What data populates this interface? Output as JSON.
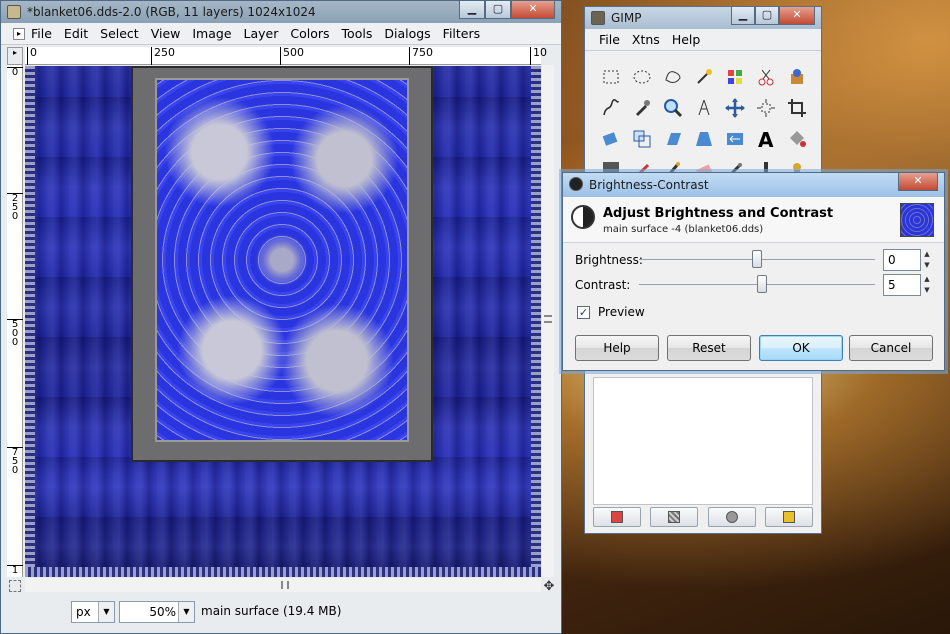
{
  "image_window": {
    "title": "*blanket06.dds-2.0 (RGB, 11 layers) 1024x1024",
    "menu": [
      "File",
      "Edit",
      "Select",
      "View",
      "Image",
      "Layer",
      "Colors",
      "Tools",
      "Dialogs",
      "Filters"
    ],
    "hruler_ticks": [
      "0",
      "250",
      "500",
      "750",
      "10"
    ],
    "vruler_ticks": [
      "0",
      "2\n5\n0",
      "5\n0\n0",
      "7\n5\n0",
      "1"
    ],
    "statusbar": {
      "unit": "px",
      "zoom": "50%",
      "status": "main surface (19.4 MB)"
    }
  },
  "toolbox": {
    "title": "GIMP",
    "menu": [
      "File",
      "Xtns",
      "Help"
    ],
    "tools": [
      "rect-select-icon",
      "ellipse-select-icon",
      "free-select-icon",
      "fuzzy-select-icon",
      "select-by-color-icon",
      "scissors-icon",
      "foreground-select-icon",
      "paths-icon",
      "color-picker-icon",
      "zoom-icon",
      "measure-icon",
      "move-icon",
      "align-icon",
      "crop-icon",
      "rotate-icon",
      "scale-icon",
      "shear-icon",
      "perspective-icon",
      "flip-icon",
      "text-icon",
      "bucket-fill-icon",
      "blend-icon",
      "pencil-icon",
      "paintbrush-icon",
      "eraser-icon",
      "airbrush-icon",
      "ink-icon",
      "clone-icon"
    ],
    "layer_buttons": [
      "new-layer-icon",
      "raise-layer-icon",
      "duplicate-icon",
      "anchor-icon"
    ]
  },
  "dialog": {
    "title": "Brightness-Contrast",
    "heading": "Adjust Brightness and Contrast",
    "subheading": "main surface -4 (blanket06.dds)",
    "brightness_label": "Brightness:",
    "brightness_value": "0",
    "brightness_level": 0.5,
    "contrast_label": "Contrast:",
    "contrast_value": "5",
    "contrast_level": 0.52,
    "preview_label": "Preview",
    "preview_checked": true,
    "buttons": {
      "help": "Help",
      "reset": "Reset",
      "ok": "OK",
      "cancel": "Cancel"
    }
  },
  "colors": {
    "accent": "#3c7fb1",
    "canvas_blue": "#242cb0"
  }
}
